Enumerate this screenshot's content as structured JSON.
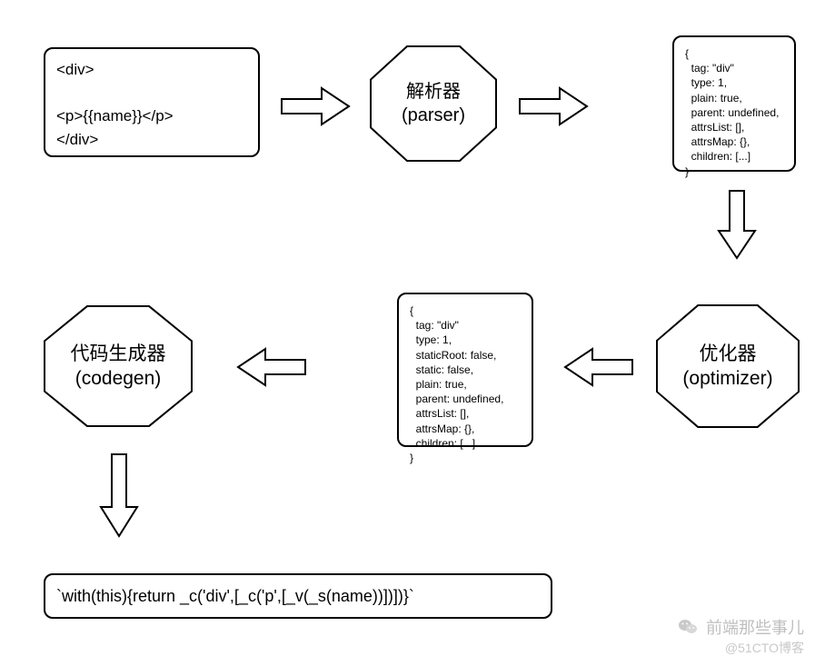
{
  "nodes": {
    "template_source": "<div>\n\n<p>{{name}}</p>\n</div>",
    "parser": {
      "zh": "解析器",
      "en": "(parser)"
    },
    "ast_raw": "{\n  tag: \"div\"\n  type: 1,\n  plain: true,\n  parent: undefined,\n  attrsList: [],\n  attrsMap: {},\n  children: [...]\n}",
    "optimizer": {
      "zh": "优化器",
      "en": "(optimizer)"
    },
    "ast_optimized": "{\n  tag: \"div\"\n  type: 1,\n  staticRoot: false,\n  static: false,\n  plain: true,\n  parent: undefined,\n  attrsList: [],\n  attrsMap: {},\n  children: [...]\n}",
    "codegen": {
      "zh": "代码生成器",
      "en": "(codegen)"
    },
    "render_fn": "`with(this){return _c('div',[_c('p',[_v(_s(name))])])}`"
  },
  "watermark": {
    "line1": "前端那些事儿",
    "line2": "@51CTO博客"
  }
}
